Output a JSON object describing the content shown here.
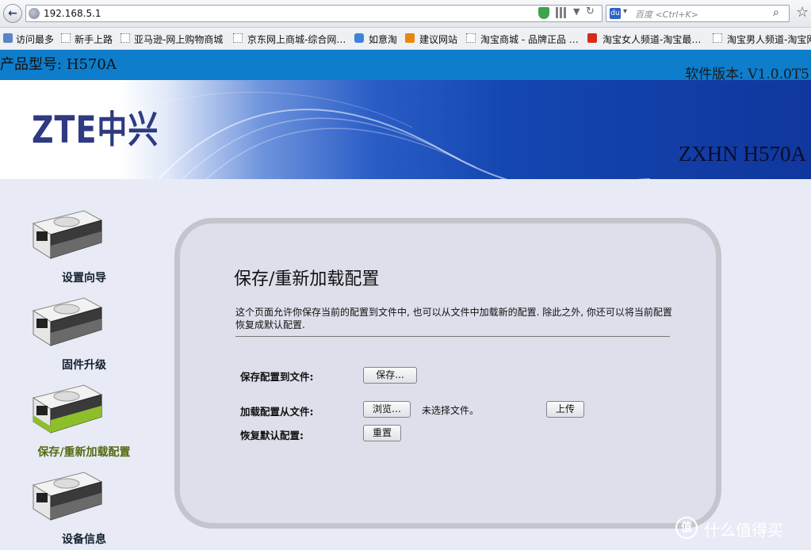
{
  "browser": {
    "url": "192.168.5.1",
    "search_placeholder": "百度 <Ctrl+K>",
    "baidu_mark": "du",
    "bookmarks": [
      "访问最多",
      "新手上路",
      "亚马逊-网上购物商城",
      "京东网上商城-综合网…",
      "如意淘",
      "建议网站",
      "淘宝商城 - 品牌正品 …",
      "淘宝女人频道-淘宝最…",
      "淘宝男人频道-淘宝网"
    ]
  },
  "header": {
    "model_label": "产品型号: H570A",
    "firmware_label": "软件版本: V1.0.0T5",
    "logo_text": "ZTE中兴",
    "model_banner": "ZXHN H570A"
  },
  "sidebar": {
    "items": [
      {
        "label": "设置向导",
        "active": false
      },
      {
        "label": "固件升级",
        "active": false
      },
      {
        "label": "保存/重新加载配置",
        "active": true
      },
      {
        "label": "设备信息",
        "active": false
      }
    ]
  },
  "main": {
    "title": "保存/重新加载配置",
    "description": "这个页面允许你保存当前的配置到文件中, 也可以从文件中加载新的配置. 除此之外, 你还可以将当前配置恢复成默认配置.",
    "save_label": "保存配置到文件:",
    "save_button": "保存...",
    "load_label": "加载配置从文件:",
    "browse_button": "浏览…",
    "no_file_text": "未选择文件。",
    "upload_button": "上传",
    "restore_label": "恢复默认配置:",
    "reset_button": "重置"
  },
  "watermark": {
    "icon_text": "值",
    "text": "什么值得买"
  },
  "colors": {
    "header_blue": "#0d7dcc",
    "banner_dark": "#10379d",
    "active_nav": "#55690f",
    "device_green": "#8dbf2a"
  }
}
